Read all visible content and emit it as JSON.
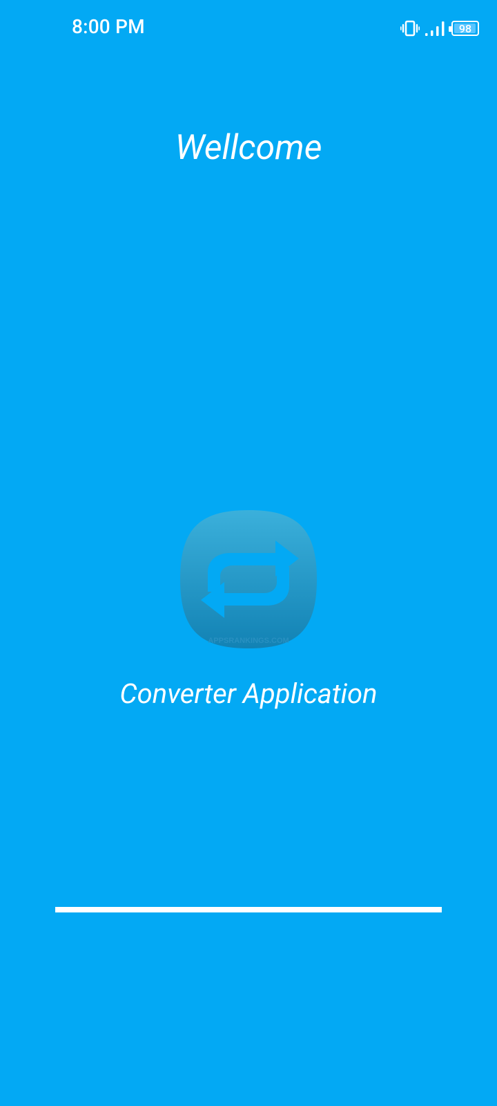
{
  "status_bar": {
    "time": "8:00 PM",
    "battery_level": 98,
    "battery_text": "98",
    "icons": [
      "vibrate-icon",
      "signal-icon",
      "battery-icon"
    ]
  },
  "splash": {
    "welcome_text": "Wellcome",
    "app_name": "Converter Application",
    "logo_watermark": "APPSRANKINGS.COM",
    "logo_icon": "swap-arrows-icon",
    "progress": 1.0
  },
  "colors": {
    "background": "#03A9F4",
    "text": "#FFFFFF",
    "logo_top": "#3BB0DB",
    "logo_bottom": "#1282B4",
    "arrows": "#03A9F4",
    "progress": "#FFFFFF"
  }
}
